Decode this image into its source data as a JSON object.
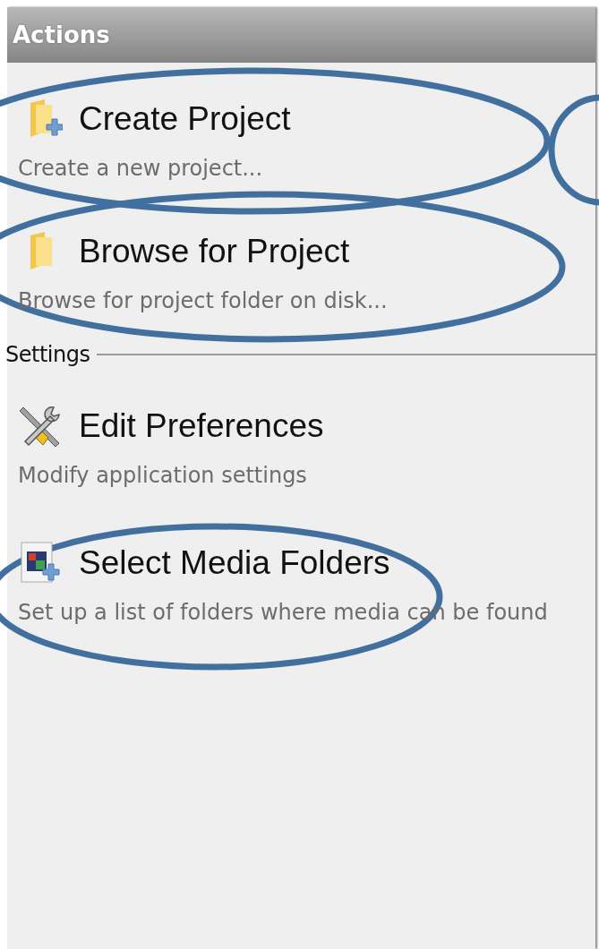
{
  "header": {
    "title": "Actions"
  },
  "sections": [
    {
      "edge_circle": true,
      "items": [
        {
          "kind": "new-folder",
          "title": "Create Project",
          "description": "Create a new project...",
          "circled": true
        },
        {
          "kind": "folder",
          "title": "Browse for Project",
          "description": "Browse for project folder on disk...",
          "circled": true
        }
      ]
    },
    {
      "label": "Settings",
      "items": [
        {
          "kind": "tools",
          "title": "Edit Preferences",
          "description": "Modify application settings",
          "circled": false
        },
        {
          "kind": "media",
          "title": "Select Media Folders",
          "description": "Set up a list of folders where media can be found",
          "circled": true
        }
      ]
    }
  ]
}
